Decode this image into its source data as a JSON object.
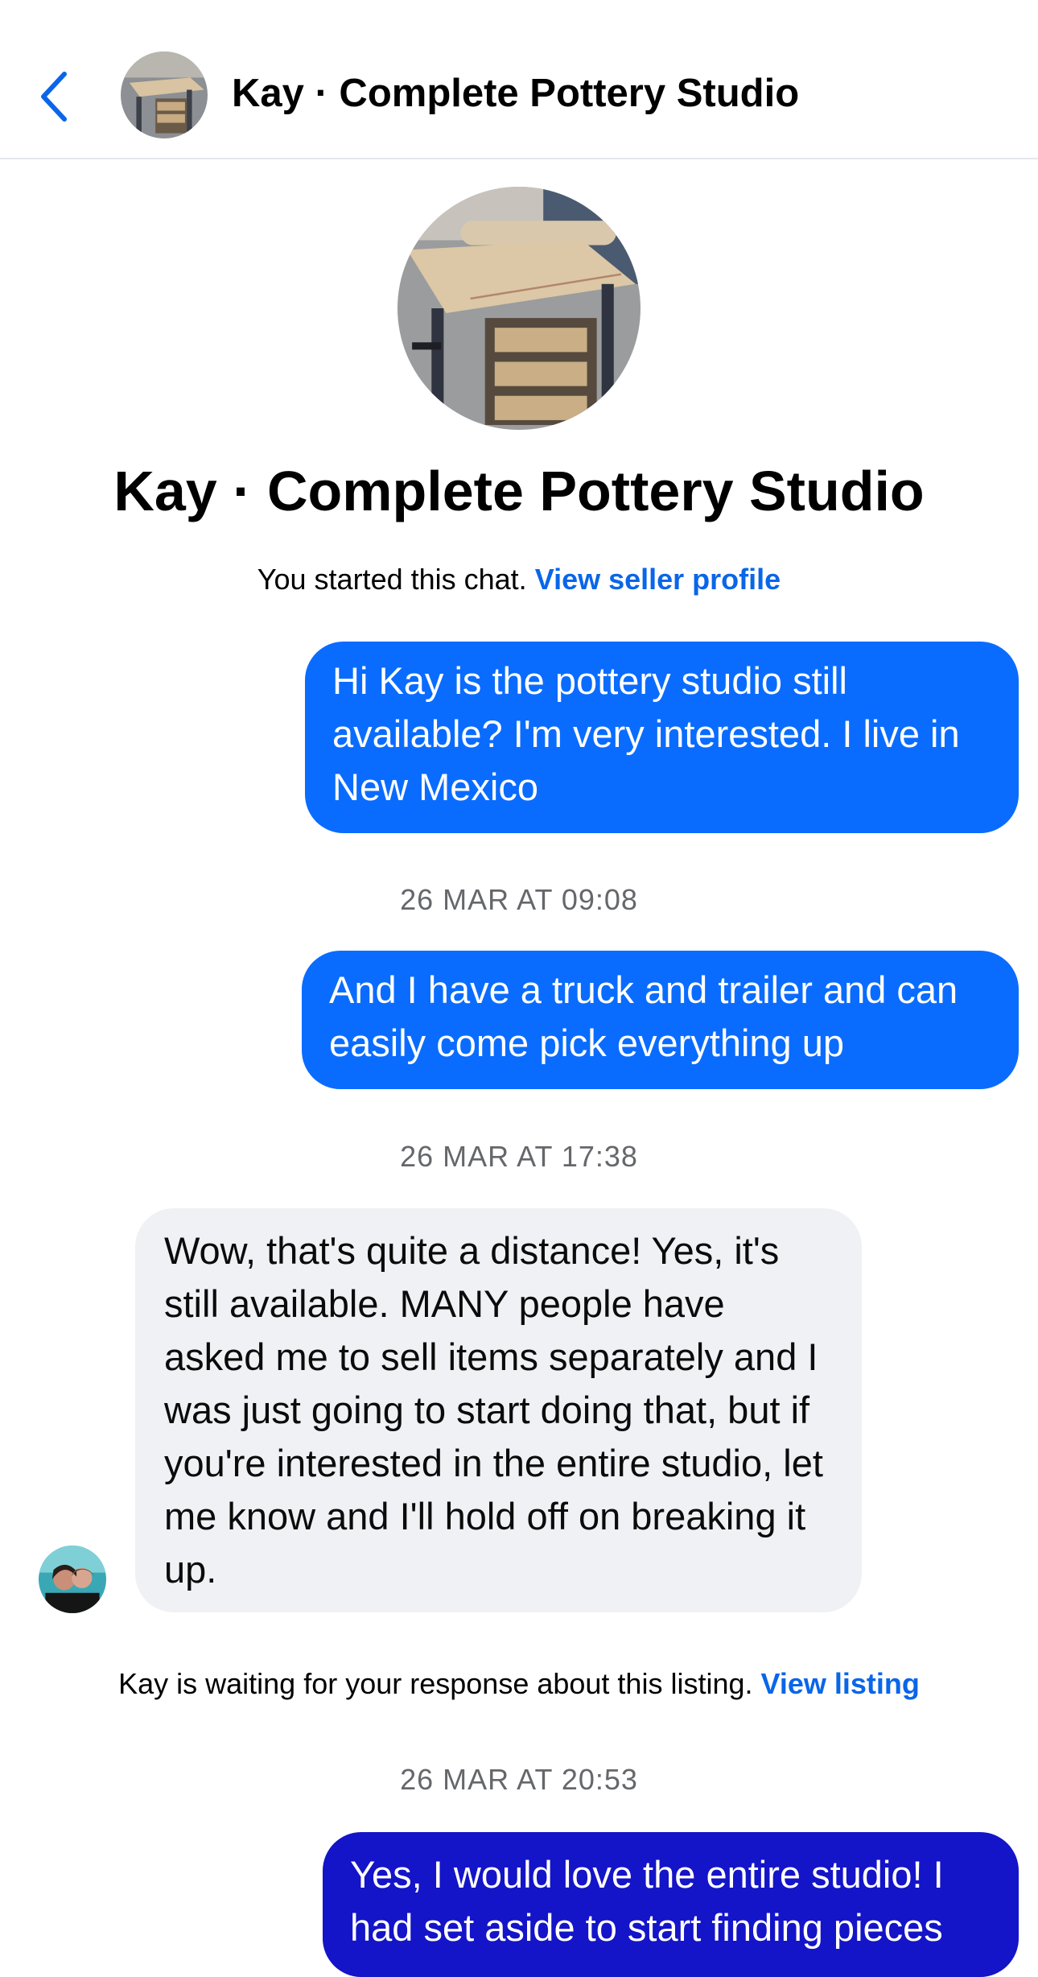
{
  "header": {
    "title": "Kay · Complete Pottery Studio",
    "back_icon": "chevron-left-icon"
  },
  "profile": {
    "name": "Kay · Complete Pottery Studio",
    "started_text": "You started this chat.",
    "seller_link": "View seller profile"
  },
  "messages": [
    {
      "direction": "outgoing",
      "text": "Hi Kay is the pottery studio still available? I'm very interested. I live in New Mexico"
    },
    {
      "direction": "outgoing",
      "text": "And I have a truck and trailer and can easily come pick everything up"
    },
    {
      "direction": "incoming",
      "text": "Wow, that's quite a distance! Yes, it's still available.  MANY people have asked me to sell items separately and I was just going to start doing that, but if you're interested in the entire studio, let me know and I'll hold off on breaking it up."
    },
    {
      "direction": "outgoing",
      "text": "Yes, I would love the entire studio! I had set aside to start finding pieces"
    }
  ],
  "timestamps": [
    "26 MAR AT 09:08",
    "26 MAR AT 17:38",
    "26 MAR AT 20:53"
  ],
  "notice": {
    "text": "Kay is waiting for your response about this listing.",
    "link": "View listing"
  },
  "colors": {
    "accent": "#0a66e8",
    "outgoing_bubble": "#0a6cff",
    "outgoing_bubble_dark": "#1414c8",
    "incoming_bubble": "#f0f1f5",
    "timestamp": "#65676b"
  }
}
